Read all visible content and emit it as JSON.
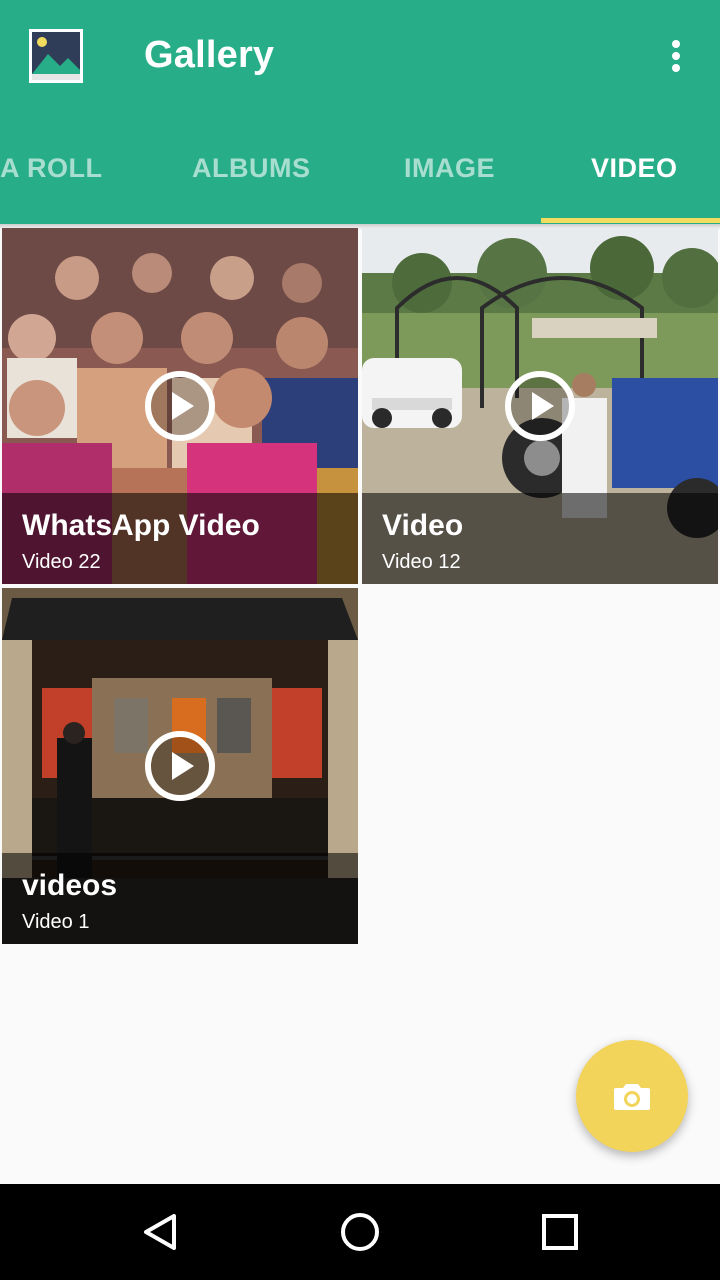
{
  "app": {
    "title": "Gallery"
  },
  "tabs": [
    {
      "label": "A ROLL",
      "active": false
    },
    {
      "label": "ALBUMS",
      "active": false
    },
    {
      "label": "IMAGE",
      "active": false
    },
    {
      "label": "VIDEO",
      "active": true
    }
  ],
  "albums": [
    {
      "title": "WhatsApp Video",
      "count": "Video 22"
    },
    {
      "title": "Video",
      "count": "Video 12"
    },
    {
      "title": "videos",
      "count": "Video 1"
    }
  ],
  "colors": {
    "primary": "#27ad88",
    "accent": "#f2dc5d",
    "fab": "#f2d45b"
  },
  "icons": {
    "app": "gallery-icon",
    "overflow": "more-vert-icon",
    "play": "play-icon",
    "fab": "camera-icon",
    "nav": [
      "back-icon",
      "home-icon",
      "recents-icon"
    ]
  }
}
